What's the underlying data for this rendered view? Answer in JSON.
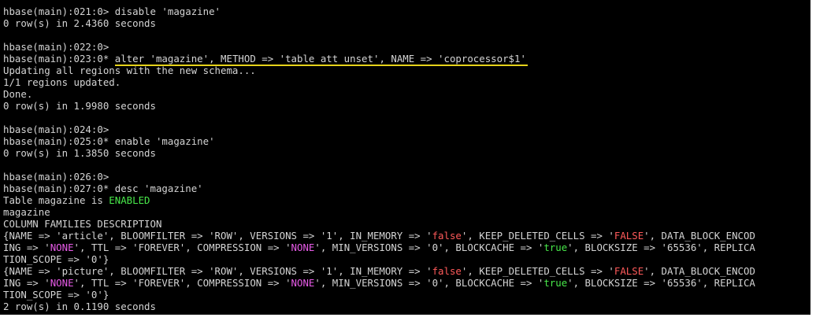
{
  "terminal": {
    "lines": [
      {
        "segments": [
          {
            "text": "hbase(main):021:0> disable 'magazine'",
            "color": "normal"
          }
        ]
      },
      {
        "segments": [
          {
            "text": "0 row(s) in 2.4360 seconds",
            "color": "normal"
          }
        ]
      },
      {
        "segments": [
          {
            "text": "",
            "color": "normal"
          }
        ]
      },
      {
        "segments": [
          {
            "text": "hbase(main):022:0>",
            "color": "normal"
          }
        ]
      },
      {
        "segments": [
          {
            "text": "hbase(main):023:0* ",
            "color": "normal"
          },
          {
            "text": "alter 'magazine', METHOD => 'table att unset', NAME => 'coprocessor$1'",
            "color": "normal",
            "underlined": true
          }
        ]
      },
      {
        "segments": [
          {
            "text": "Updating all regions with the new schema...",
            "color": "normal"
          }
        ]
      },
      {
        "segments": [
          {
            "text": "1/1 regions updated.",
            "color": "normal"
          }
        ]
      },
      {
        "segments": [
          {
            "text": "Done.",
            "color": "normal"
          }
        ]
      },
      {
        "segments": [
          {
            "text": "0 row(s) in 1.9980 seconds",
            "color": "normal"
          }
        ]
      },
      {
        "segments": [
          {
            "text": "",
            "color": "normal"
          }
        ]
      },
      {
        "segments": [
          {
            "text": "hbase(main):024:0>",
            "color": "normal"
          }
        ]
      },
      {
        "segments": [
          {
            "text": "hbase(main):025:0* enable 'magazine'",
            "color": "normal"
          }
        ]
      },
      {
        "segments": [
          {
            "text": "0 row(s) in 1.3850 seconds",
            "color": "normal"
          }
        ]
      },
      {
        "segments": [
          {
            "text": "",
            "color": "normal"
          }
        ]
      },
      {
        "segments": [
          {
            "text": "hbase(main):026:0>",
            "color": "normal"
          }
        ]
      },
      {
        "segments": [
          {
            "text": "hbase(main):027:0* desc 'magazine'",
            "color": "normal"
          }
        ]
      },
      {
        "segments": [
          {
            "text": "Table magazine is ",
            "color": "normal"
          },
          {
            "text": "ENABLED",
            "color": "green"
          }
        ]
      },
      {
        "segments": [
          {
            "text": "magazine",
            "color": "normal"
          }
        ]
      },
      {
        "segments": [
          {
            "text": "COLUMN FAMILIES DESCRIPTION",
            "color": "normal"
          }
        ]
      },
      {
        "segments": [
          {
            "text": "{NAME => 'article', BLOOMFILTER => 'ROW', VERSIONS => '1', IN_MEMORY => '",
            "color": "normal"
          },
          {
            "text": "false",
            "color": "red"
          },
          {
            "text": "', KEEP_DELETED_CELLS => '",
            "color": "normal"
          },
          {
            "text": "FALSE",
            "color": "red"
          },
          {
            "text": "', DATA_BLOCK_ENCOD",
            "color": "normal"
          }
        ]
      },
      {
        "segments": [
          {
            "text": "ING => '",
            "color": "normal"
          },
          {
            "text": "NONE",
            "color": "magenta"
          },
          {
            "text": "', TTL => 'FOREVER', COMPRESSION => '",
            "color": "normal"
          },
          {
            "text": "NONE",
            "color": "magenta"
          },
          {
            "text": "', MIN_VERSIONS => '0', BLOCKCACHE => '",
            "color": "normal"
          },
          {
            "text": "true",
            "color": "green"
          },
          {
            "text": "', BLOCKSIZE => '65536', REPLICA",
            "color": "normal"
          }
        ]
      },
      {
        "segments": [
          {
            "text": "TION_SCOPE => '0'}",
            "color": "normal"
          }
        ]
      },
      {
        "segments": [
          {
            "text": "{NAME => 'picture', BLOOMFILTER => 'ROW', VERSIONS => '1', IN_MEMORY => '",
            "color": "normal"
          },
          {
            "text": "false",
            "color": "red"
          },
          {
            "text": "', KEEP_DELETED_CELLS => '",
            "color": "normal"
          },
          {
            "text": "FALSE",
            "color": "red"
          },
          {
            "text": "', DATA_BLOCK_ENCOD",
            "color": "normal"
          }
        ]
      },
      {
        "segments": [
          {
            "text": "ING => '",
            "color": "normal"
          },
          {
            "text": "NONE",
            "color": "magenta"
          },
          {
            "text": "', TTL => 'FOREVER', COMPRESSION => '",
            "color": "normal"
          },
          {
            "text": "NONE",
            "color": "magenta"
          },
          {
            "text": "', MIN_VERSIONS => '0', BLOCKCACHE => '",
            "color": "normal"
          },
          {
            "text": "true",
            "color": "green"
          },
          {
            "text": "', BLOCKSIZE => '65536', REPLICA",
            "color": "normal"
          }
        ]
      },
      {
        "segments": [
          {
            "text": "TION_SCOPE => '0'}",
            "color": "normal"
          }
        ]
      },
      {
        "segments": [
          {
            "text": "2 row(s) in 0.1190 seconds",
            "color": "normal"
          }
        ]
      }
    ]
  },
  "colors": {
    "background": "#000000",
    "normal": "#d4d4d4",
    "magenta": "#e85be8",
    "green": "#48e84a",
    "red": "#ff5a5a",
    "underline": "#e6d21a"
  }
}
